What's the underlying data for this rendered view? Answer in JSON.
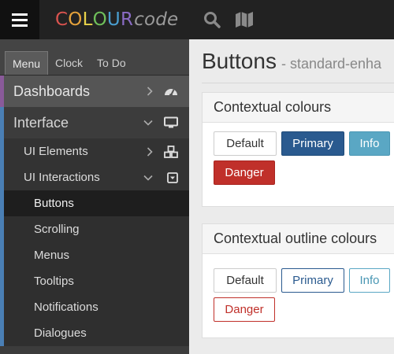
{
  "topbar": {
    "menu_icon": "hamburger-menu-icon",
    "logo": {
      "letters": [
        {
          "ch": "C",
          "color": "#d9534f"
        },
        {
          "ch": "O",
          "color": "#e5a23b"
        },
        {
          "ch": "L",
          "color": "#e8d24a"
        },
        {
          "ch": "O",
          "color": "#6fbf5a"
        },
        {
          "ch": "U",
          "color": "#4a9fd1"
        },
        {
          "ch": "R",
          "color": "#8a6bc4"
        }
      ],
      "suffix": "code"
    },
    "icons": [
      "search-icon",
      "map-icon"
    ]
  },
  "sidebar": {
    "tabs": [
      {
        "label": "Menu",
        "active": true
      },
      {
        "label": "Clock",
        "active": false
      },
      {
        "label": "To Do",
        "active": false
      }
    ],
    "items": [
      {
        "label": "Dashboards",
        "level": 1,
        "icon": "dashboard-gauge-icon",
        "chevron": "right"
      },
      {
        "label": "Interface",
        "level": 1,
        "icon": "monitor-icon",
        "chevron": "down"
      },
      {
        "label": "UI Elements",
        "level": 2,
        "icon": "cubes-icon",
        "chevron": "right"
      },
      {
        "label": "UI Interactions",
        "level": 2,
        "icon": "caret-square-down-icon",
        "chevron": "down"
      },
      {
        "label": "Buttons",
        "level": 3,
        "active": true
      },
      {
        "label": "Scrolling",
        "level": 3
      },
      {
        "label": "Menus",
        "level": 3
      },
      {
        "label": "Tooltips",
        "level": 3
      },
      {
        "label": "Notifications",
        "level": 3
      },
      {
        "label": "Dialogues",
        "level": 3
      }
    ],
    "accent_colors": {
      "dashboards": "#8a5a9a",
      "interface": "#4a7fb5"
    }
  },
  "main": {
    "title": "Buttons",
    "subtitle": "- standard-enha",
    "panels": [
      {
        "heading": "Contextual colours",
        "buttons": [
          {
            "label": "Default",
            "style": "default"
          },
          {
            "label": "Primary",
            "style": "primary"
          },
          {
            "label": "Info",
            "style": "info"
          },
          {
            "label": "Danger",
            "style": "danger"
          }
        ]
      },
      {
        "heading": "Contextual outline colours",
        "buttons": [
          {
            "label": "Default",
            "style": "o-default"
          },
          {
            "label": "Primary",
            "style": "o-primary"
          },
          {
            "label": "Info",
            "style": "o-info"
          },
          {
            "label": "Danger",
            "style": "o-danger"
          }
        ]
      }
    ]
  },
  "colors": {
    "primary": "#2a5a8f",
    "info": "#5aa7c4",
    "danger": "#c0302a"
  }
}
